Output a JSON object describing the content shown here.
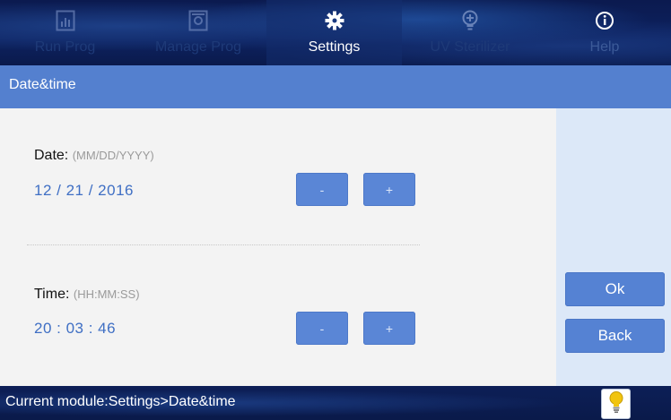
{
  "tabs": [
    {
      "label": "Run Prog",
      "icon": "chart-icon"
    },
    {
      "label": "Manage Prog",
      "icon": "manage-icon"
    },
    {
      "label": "Settings",
      "icon": "gear-icon"
    },
    {
      "label": "UV Sterilizer",
      "icon": "uv-lamp-icon"
    },
    {
      "label": "Help",
      "icon": "info-icon"
    }
  ],
  "page_title": "Date&time",
  "date": {
    "label": "Date:",
    "hint": "(MM/DD/YYYY)",
    "value": "12 / 21 / 2016",
    "minus_label": "-",
    "plus_label": "+"
  },
  "time": {
    "label": "Time:",
    "hint": "(HH:MM:SS)",
    "value": "20 : 03 : 46",
    "minus_label": "-",
    "plus_label": "+"
  },
  "actions": {
    "ok_label": "Ok",
    "back_label": "Back"
  },
  "status": {
    "text": "Current module:Settings>Date&time"
  },
  "colors": {
    "accent": "#5480cf",
    "value_text": "#3f6fc4",
    "side_panel": "#dce8f8"
  }
}
